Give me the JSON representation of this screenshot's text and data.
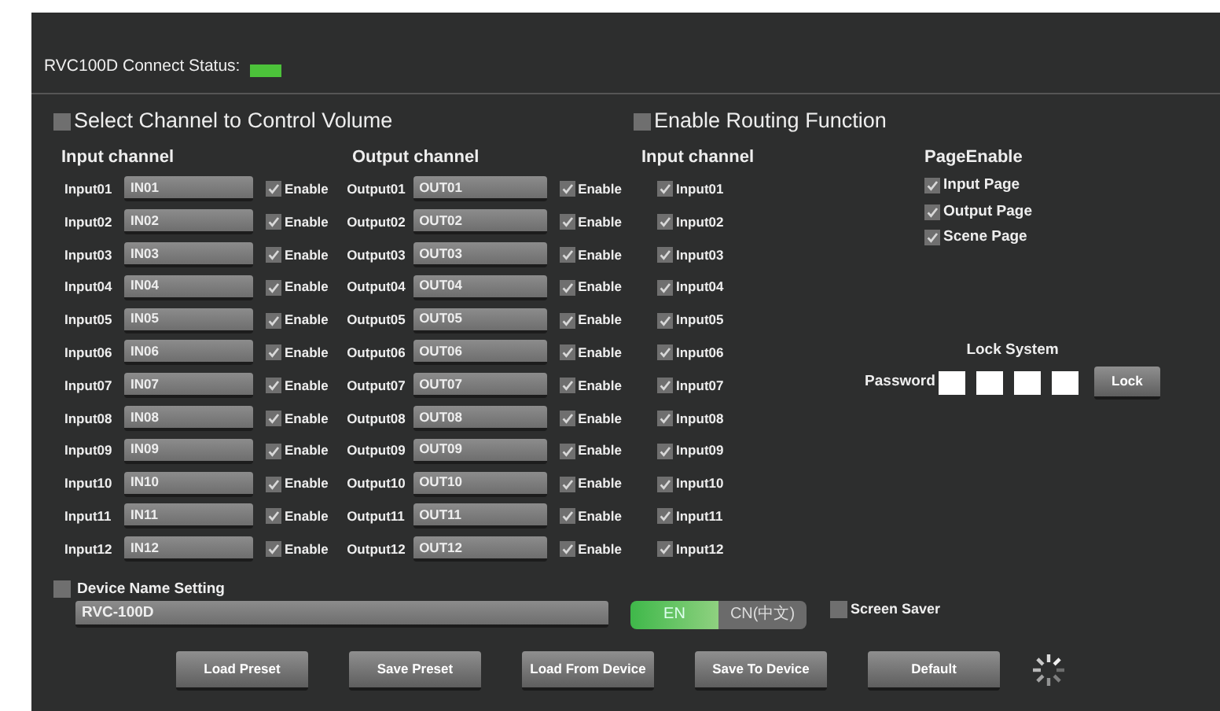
{
  "header": {
    "label": "RVC100D Connect Status:",
    "connected": true
  },
  "volume_section": {
    "title": "Select Channel to Control Volume",
    "checked": false,
    "input_heading": "Input channel",
    "output_heading": "Output channel",
    "inputs": [
      {
        "label": "Input01",
        "value": "IN01",
        "enabled": true,
        "enable_label": "Enable"
      },
      {
        "label": "Input02",
        "value": "IN02",
        "enabled": true,
        "enable_label": "Enable"
      },
      {
        "label": "Input03",
        "value": "IN03",
        "enabled": true,
        "enable_label": "Enable"
      },
      {
        "label": "Input04",
        "value": "IN04",
        "enabled": true,
        "enable_label": "Enable"
      },
      {
        "label": "Input05",
        "value": "IN05",
        "enabled": true,
        "enable_label": "Enable"
      },
      {
        "label": "Input06",
        "value": "IN06",
        "enabled": true,
        "enable_label": "Enable"
      },
      {
        "label": "Input07",
        "value": "IN07",
        "enabled": true,
        "enable_label": "Enable"
      },
      {
        "label": "Input08",
        "value": "IN08",
        "enabled": true,
        "enable_label": "Enable"
      },
      {
        "label": "Input09",
        "value": "IN09",
        "enabled": true,
        "enable_label": "Enable"
      },
      {
        "label": "Input10",
        "value": "IN10",
        "enabled": true,
        "enable_label": "Enable"
      },
      {
        "label": "Input11",
        "value": "IN11",
        "enabled": true,
        "enable_label": "Enable"
      },
      {
        "label": "Input12",
        "value": "IN12",
        "enabled": true,
        "enable_label": "Enable"
      }
    ],
    "outputs": [
      {
        "label": "Output01",
        "value": "OUT01",
        "enabled": true,
        "enable_label": "Enable"
      },
      {
        "label": "Output02",
        "value": "OUT02",
        "enabled": true,
        "enable_label": "Enable"
      },
      {
        "label": "Output03",
        "value": "OUT03",
        "enabled": true,
        "enable_label": "Enable"
      },
      {
        "label": "Output04",
        "value": "OUT04",
        "enabled": true,
        "enable_label": "Enable"
      },
      {
        "label": "Output05",
        "value": "OUT05",
        "enabled": true,
        "enable_label": "Enable"
      },
      {
        "label": "Output06",
        "value": "OUT06",
        "enabled": true,
        "enable_label": "Enable"
      },
      {
        "label": "Output07",
        "value": "OUT07",
        "enabled": true,
        "enable_label": "Enable"
      },
      {
        "label": "Output08",
        "value": "OUT08",
        "enabled": true,
        "enable_label": "Enable"
      },
      {
        "label": "Output09",
        "value": "OUT09",
        "enabled": true,
        "enable_label": "Enable"
      },
      {
        "label": "Output10",
        "value": "OUT10",
        "enabled": true,
        "enable_label": "Enable"
      },
      {
        "label": "Output11",
        "value": "OUT11",
        "enabled": true,
        "enable_label": "Enable"
      },
      {
        "label": "Output12",
        "value": "OUT12",
        "enabled": true,
        "enable_label": "Enable"
      }
    ]
  },
  "routing_section": {
    "title": "Enable Routing Function",
    "checked": false,
    "heading": "Input channel",
    "inputs": [
      {
        "label": "Input01",
        "checked": true
      },
      {
        "label": "Input02",
        "checked": true
      },
      {
        "label": "Input03",
        "checked": true
      },
      {
        "label": "Input04",
        "checked": true
      },
      {
        "label": "Input05",
        "checked": true
      },
      {
        "label": "Input06",
        "checked": true
      },
      {
        "label": "Input07",
        "checked": true
      },
      {
        "label": "Input08",
        "checked": true
      },
      {
        "label": "Input09",
        "checked": true
      },
      {
        "label": "Input10",
        "checked": true
      },
      {
        "label": "Input11",
        "checked": true
      },
      {
        "label": "Input12",
        "checked": true
      }
    ]
  },
  "page_enable": {
    "heading": "PageEnable",
    "items": [
      {
        "label": "Input Page",
        "checked": true
      },
      {
        "label": "Output Page",
        "checked": true
      },
      {
        "label": "Scene Page",
        "checked": true
      }
    ]
  },
  "lock": {
    "heading": "Lock System",
    "password_label": "Password",
    "button": "Lock"
  },
  "device_name": {
    "label": "Device Name Setting",
    "checked": false,
    "value": "RVC-100D"
  },
  "language": [
    {
      "label": "EN",
      "selected": true
    },
    {
      "label": "CN(中文)",
      "selected": false
    }
  ],
  "screen_saver": {
    "label": "Screen Saver",
    "checked": false
  },
  "buttons": [
    "Load Preset",
    "Save Preset",
    "Load From Device",
    "Save To Device",
    "Default"
  ]
}
